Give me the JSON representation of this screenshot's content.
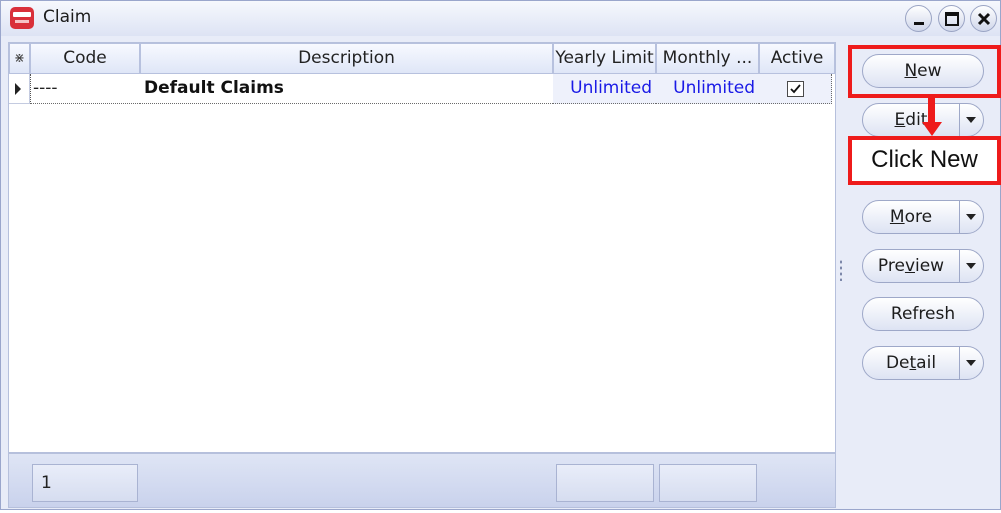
{
  "window": {
    "title": "Claim",
    "icons": {
      "app": "sql-payroll-app-icon",
      "minimize": "minimize-icon",
      "maximize": "maximize-icon",
      "close": "close-icon"
    }
  },
  "grid": {
    "columns": [
      "Code",
      "Description",
      "Yearly Limit",
      "Monthly ...",
      "Active"
    ],
    "corner_glyph": "⋇",
    "rows": [
      {
        "code": "----",
        "description": "Default Claims",
        "yearly_limit": "Unlimited",
        "monthly_limit": "Unlimited",
        "active": true
      }
    ]
  },
  "footer": {
    "count": "1"
  },
  "sidebar": {
    "new_label": "New",
    "edit_label": "Edit",
    "more_label": "More",
    "preview_label": "Preview",
    "refresh_label": "Refresh",
    "detail_label": "Detail"
  },
  "annotation": {
    "callout_text": "Click New",
    "highlight_color": "#ee1b1b"
  },
  "colors": {
    "accent_blue": "#1a1ae6",
    "window_bg": "#e8ecf8"
  }
}
